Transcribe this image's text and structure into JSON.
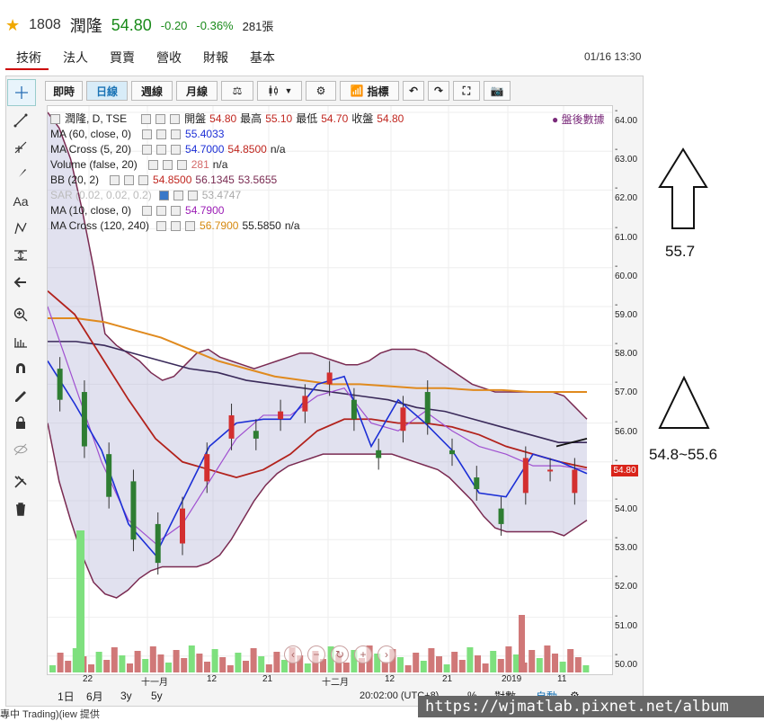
{
  "header": {
    "code": "1808",
    "name": "潤隆",
    "price": "54.80",
    "change": "-0.20",
    "change_pct": "-0.36%",
    "volume": "281張"
  },
  "tabs": [
    "技術",
    "法人",
    "營收",
    "營收",
    "財報",
    "基本"
  ],
  "tabs_fixed": [
    "技術",
    "法人",
    "買賣",
    "營收",
    "財報",
    "基本"
  ],
  "datetime": "01/16 13:30",
  "toolbar": {
    "realtime": "即時",
    "daily": "日線",
    "weekly": "週線",
    "monthly": "月線",
    "indicators": "指標"
  },
  "legend": {
    "main_label": "潤隆, D, TSE",
    "open_label": "開盤",
    "open": "54.80",
    "high_label": "最高",
    "high": "55.10",
    "low_label": "最低",
    "low": "54.70",
    "close_label": "收盤",
    "close": "54.80",
    "after_hours": "盤後數據",
    "ma60_label": "MA (60, close, 0)",
    "ma60_val": "55.4033",
    "macross1_label": "MA Cross (5, 20)",
    "macross1_a": "54.7000",
    "macross1_b": "54.8500",
    "macross1_c": "n/a",
    "volume_label": "Volume (false, 20)",
    "volume_val": "281",
    "volume_na": "n/a",
    "bb_label": "BB (20, 2)",
    "bb_a": "54.8500",
    "bb_b": "56.1345",
    "bb_c": "53.5655",
    "sar_label": "SAR (0.02, 0.02, 0.2)",
    "sar_val": "53.4747",
    "ma10_label": "MA (10, close, 0)",
    "ma10_val": "54.7900",
    "macross2_label": "MA Cross (120, 240)",
    "macross2_a": "56.7900",
    "macross2_b": "55.5850",
    "macross2_c": "n/a"
  },
  "price_axis": [
    "64.00",
    "63.00",
    "62.00",
    "61.00",
    "60.00",
    "59.00",
    "58.00",
    "57.00",
    "56.00",
    "55.00",
    "54.00",
    "53.00",
    "52.00",
    "51.00",
    "50.00"
  ],
  "price_tag": "54.80",
  "x_axis": [
    "22",
    "十一月",
    "12",
    "21",
    "十二月",
    "12",
    "21",
    "2019",
    "11"
  ],
  "bottom": {
    "r1d": "1日",
    "r6m": "6月",
    "r3y": "3y",
    "r5y": "5y",
    "time": "20:02:00 (UTC+8)",
    "pct": "%",
    "log": "對數",
    "auto": "自動"
  },
  "annotations": {
    "target_up": "55.7",
    "target_range": "54.8~55.6"
  },
  "watermark": "https://wjmatlab.pixnet.net/album",
  "footer": "專中 Trading)(iew 提供"
}
